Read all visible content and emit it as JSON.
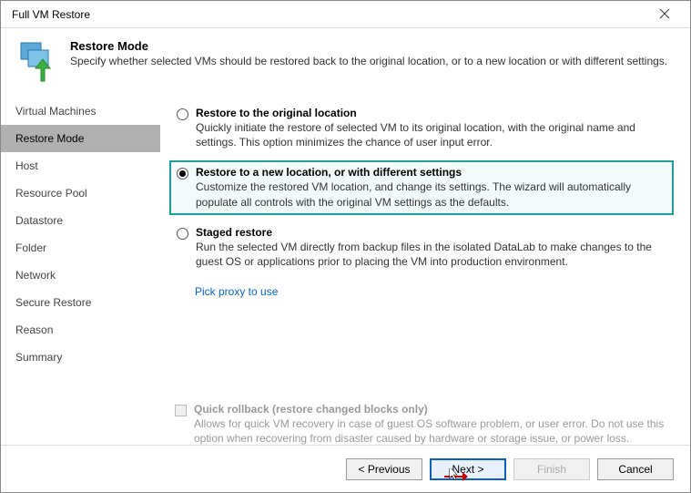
{
  "window": {
    "title": "Full VM Restore"
  },
  "header": {
    "title": "Restore Mode",
    "subtitle": "Specify whether selected VMs should be restored back to the original location, or to a new location or with different settings."
  },
  "sidebar": {
    "items": [
      {
        "label": "Virtual Machines"
      },
      {
        "label": "Restore Mode"
      },
      {
        "label": "Host"
      },
      {
        "label": "Resource Pool"
      },
      {
        "label": "Datastore"
      },
      {
        "label": "Folder"
      },
      {
        "label": "Network"
      },
      {
        "label": "Secure Restore"
      },
      {
        "label": "Reason"
      },
      {
        "label": "Summary"
      }
    ],
    "active_index": 1
  },
  "options": [
    {
      "title": "Restore to the original location",
      "desc": "Quickly initiate the restore of selected VM to its original location, with the original name and settings. This option minimizes the chance of user input error."
    },
    {
      "title": "Restore to a new location, or with different settings",
      "desc": "Customize the restored VM location, and change its settings. The wizard will automatically populate all controls with the original VM settings as the defaults."
    },
    {
      "title": "Staged restore",
      "desc": "Run the selected VM directly from backup files in the isolated DataLab to make changes to the guest OS or applications prior to placing the VM into production environment."
    }
  ],
  "selected_option": 1,
  "link_text": "Pick proxy to use",
  "quick_rollback": {
    "title": "Quick rollback (restore changed blocks only)",
    "desc": "Allows for quick VM recovery in case of guest OS software problem, or user error. Do not use this option when recovering from disaster caused by hardware or storage issue, or power loss."
  },
  "footer": {
    "previous": "< Previous",
    "next": "Next >",
    "finish": "Finish",
    "cancel": "Cancel"
  }
}
